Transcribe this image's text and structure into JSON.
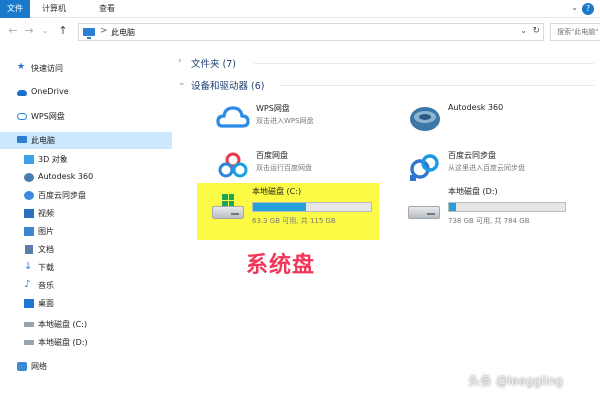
{
  "ribbon": {
    "tabs": [
      {
        "label": "文件",
        "active": true
      },
      {
        "label": "计算机",
        "active": false
      },
      {
        "label": "查看",
        "active": false
      }
    ],
    "help_icon": "help-icon"
  },
  "address_bar": {
    "path_label": "此电脑",
    "separator": ">",
    "search_placeholder": "搜索\"此电脑\""
  },
  "sidebar": {
    "items": [
      {
        "label": "快速访问",
        "icon": "pin-icon"
      },
      {
        "label": "OneDrive",
        "icon": "onedrive-icon"
      },
      {
        "label": "WPS网盘",
        "icon": "wps-cloud-icon"
      },
      {
        "label": "此电脑",
        "icon": "computer-icon",
        "selected": true
      },
      {
        "label": "3D 对象",
        "icon": "3d-objects-icon"
      },
      {
        "label": "Autodesk 360",
        "icon": "autodesk-icon"
      },
      {
        "label": "百度云同步盘",
        "icon": "baidu-sync-icon"
      },
      {
        "label": "视频",
        "icon": "video-icon"
      },
      {
        "label": "图片",
        "icon": "pictures-icon"
      },
      {
        "label": "文档",
        "icon": "documents-icon"
      },
      {
        "label": "下载",
        "icon": "download-icon"
      },
      {
        "label": "音乐",
        "icon": "music-icon"
      },
      {
        "label": "桌面",
        "icon": "desktop-icon"
      },
      {
        "label": "本地磁盘 (C:)",
        "icon": "drive-icon"
      },
      {
        "label": "本地磁盘 (D:)",
        "icon": "drive-icon"
      },
      {
        "label": "网络",
        "icon": "network-icon"
      }
    ]
  },
  "main": {
    "folders_group": {
      "label": "文件夹 (7)",
      "expanded": false
    },
    "devices_group": {
      "label": "设备和驱动器 (6)",
      "expanded": true
    },
    "tiles": {
      "wps": {
        "name": "WPS网盘",
        "desc": "双击进入WPS网盘",
        "icon": "wps-cloud-icon"
      },
      "autodesk": {
        "name": "Autodesk 360",
        "icon": "autodesk-icon"
      },
      "baidu_pan": {
        "name": "百度网盘",
        "desc": "双击运行百度网盘",
        "icon": "baidu-pan-icon"
      },
      "baidu_sync": {
        "name": "百度云同步盘",
        "desc": "从这里进入百度云同步盘",
        "icon": "baidu-sync-icon"
      },
      "drive_c": {
        "name": "本地磁盘 (C:)",
        "size_text": "63.3 GB 可用, 共 115 GB",
        "used_fraction": 0.45,
        "icon": "windows-drive-icon"
      },
      "drive_d": {
        "name": "本地磁盘 (D:)",
        "size_text": "738 GB 可用, 共 784 GB",
        "used_fraction": 0.06,
        "icon": "drive-icon"
      }
    }
  },
  "annotation": {
    "text": "系统盘",
    "color": "#f3355a"
  },
  "watermark": {
    "text": "头条 @leeggling"
  },
  "colors": {
    "accent": "#1979ca",
    "highlight": "#fbfb45",
    "bar": "#26a0da"
  }
}
